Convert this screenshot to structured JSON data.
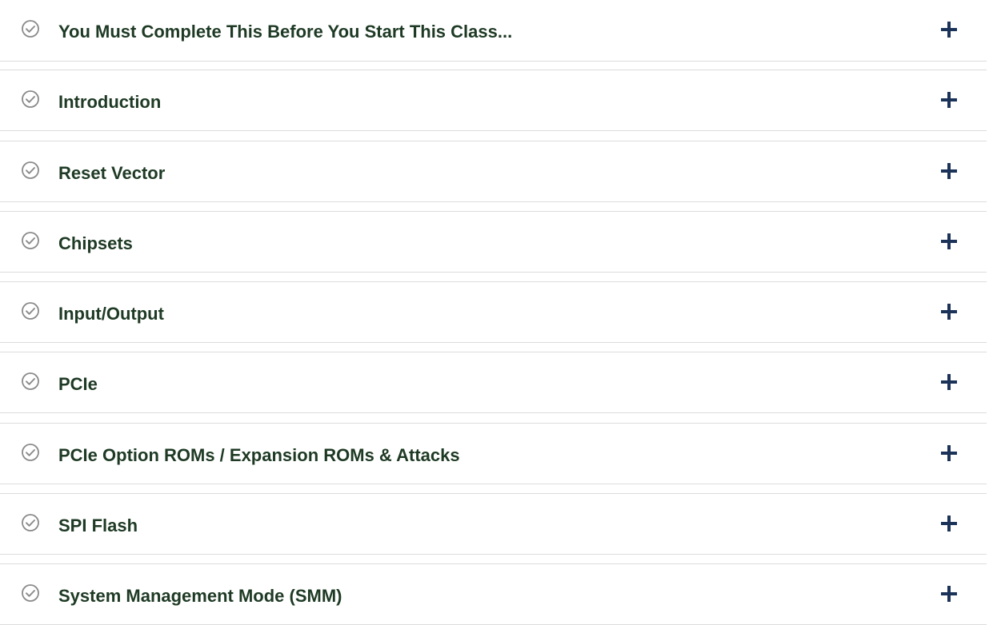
{
  "colors": {
    "title_text": "#1e3a24",
    "check_icon": "#8a8a8a",
    "plus_icon": "#1b3358",
    "divider": "#dcdcdc"
  },
  "sections": [
    {
      "title": "You Must Complete This Before You Start This Class...",
      "status_icon": "check-circle-icon",
      "toggle_icon": "plus-icon"
    },
    {
      "title": "Introduction",
      "status_icon": "check-circle-icon",
      "toggle_icon": "plus-icon"
    },
    {
      "title": "Reset Vector",
      "status_icon": "check-circle-icon",
      "toggle_icon": "plus-icon"
    },
    {
      "title": "Chipsets",
      "status_icon": "check-circle-icon",
      "toggle_icon": "plus-icon"
    },
    {
      "title": "Input/Output",
      "status_icon": "check-circle-icon",
      "toggle_icon": "plus-icon"
    },
    {
      "title": "PCIe",
      "status_icon": "check-circle-icon",
      "toggle_icon": "plus-icon"
    },
    {
      "title": "PCIe Option ROMs / Expansion ROMs & Attacks",
      "status_icon": "check-circle-icon",
      "toggle_icon": "plus-icon"
    },
    {
      "title": "SPI Flash",
      "status_icon": "check-circle-icon",
      "toggle_icon": "plus-icon"
    },
    {
      "title": "System Management Mode (SMM)",
      "status_icon": "check-circle-icon",
      "toggle_icon": "plus-icon"
    }
  ]
}
